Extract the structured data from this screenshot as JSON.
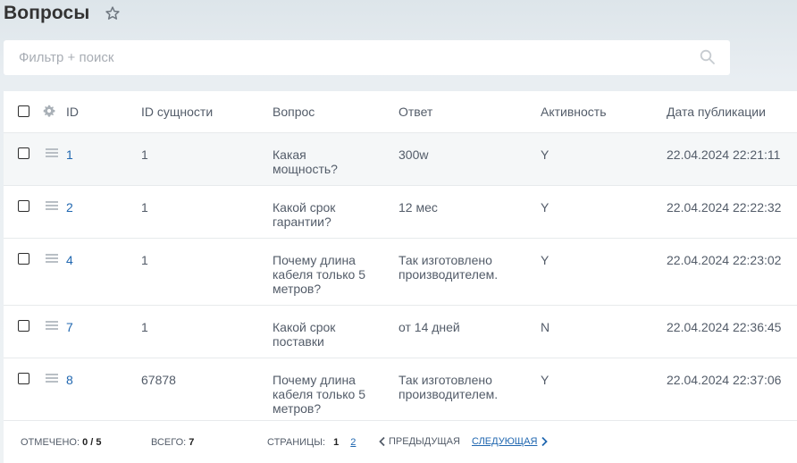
{
  "page": {
    "title": "Вопросы"
  },
  "filter": {
    "placeholder": "Фильтр + поиск"
  },
  "table": {
    "headers": {
      "id": "ID",
      "entity_id": "ID сущности",
      "question": "Вопрос",
      "answer": "Ответ",
      "active": "Активность",
      "published": "Дата публикации"
    },
    "rows": [
      {
        "id": "1",
        "entity_id": "1",
        "question": "Какая мощность?",
        "answer": "300w",
        "active": "Y",
        "published": "22.04.2024 22:21:11"
      },
      {
        "id": "2",
        "entity_id": "1",
        "question": "Какой срок гарантии?",
        "answer": "12 мес",
        "active": "Y",
        "published": "22.04.2024 22:22:32"
      },
      {
        "id": "4",
        "entity_id": "1",
        "question": "Почему длина кабеля только 5 метров?",
        "answer": "Так изготовлено производителем.",
        "active": "Y",
        "published": "22.04.2024 22:23:02"
      },
      {
        "id": "7",
        "entity_id": "1",
        "question": "Какой срок поставки",
        "answer": "от 14 дней",
        "active": "N",
        "published": "22.04.2024 22:36:45"
      },
      {
        "id": "8",
        "entity_id": "67878",
        "question": "Почему длина кабеля только 5 метров?",
        "answer": "Так изготовлено производителем.",
        "active": "Y",
        "published": "22.04.2024 22:37:06"
      }
    ]
  },
  "footer": {
    "selected_label": "Отмечено:",
    "selected_value": "0 / 5",
    "total_label": "Всего:",
    "total_value": "7",
    "pages_label": "Страницы:",
    "current_page": "1",
    "next_page": "2",
    "prev_label": "Предыдущая",
    "next_label": "Следующая"
  },
  "icons": {
    "favorite": "star-icon",
    "search": "search-icon",
    "settings": "gear-icon",
    "drag": "drag-handle-icon",
    "prev": "chevron-left-icon",
    "next": "chevron-right-icon"
  },
  "colors": {
    "link": "#2067b0",
    "text": "#535c69",
    "title": "#333333"
  }
}
